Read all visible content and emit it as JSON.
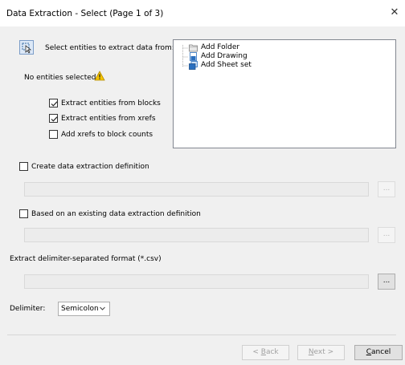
{
  "window": {
    "title": "Data Extraction - Select (Page 1 of 3)",
    "close_glyph": "✕"
  },
  "select_entities": {
    "label": "Select entities to extract data from:",
    "icon": "select-objects-icon"
  },
  "status": {
    "text": "No entities selected",
    "icon": "warning-icon"
  },
  "options": [
    {
      "label": "Extract entities from blocks",
      "checked": true
    },
    {
      "label": "Extract entities from xrefs",
      "checked": true
    },
    {
      "label": "Add xrefs to block counts",
      "checked": false
    }
  ],
  "tree": {
    "items": [
      {
        "label": "Add Folder",
        "icon": "folder-icon"
      },
      {
        "label": "Add Drawing",
        "icon": "drawing-icon"
      },
      {
        "label": "Add Sheet set",
        "icon": "sheet-set-icon"
      }
    ]
  },
  "create_definition": {
    "label": "Create data extraction definition",
    "checked": false,
    "browse": "..."
  },
  "existing_definition": {
    "label": "Based on an existing data extraction definition",
    "checked": false,
    "browse": "..."
  },
  "csv": {
    "label": "Extract delimiter-separated format (*.csv)",
    "browse": "..."
  },
  "delimiter": {
    "label": "Delimiter:",
    "value": "Semicolon"
  },
  "buttons": {
    "back": {
      "prefix": "< ",
      "accel": "B",
      "rest": "ack"
    },
    "next": {
      "accel": "N",
      "rest": "ext >"
    },
    "cancel": {
      "accel": "C",
      "rest": "ancel"
    }
  }
}
